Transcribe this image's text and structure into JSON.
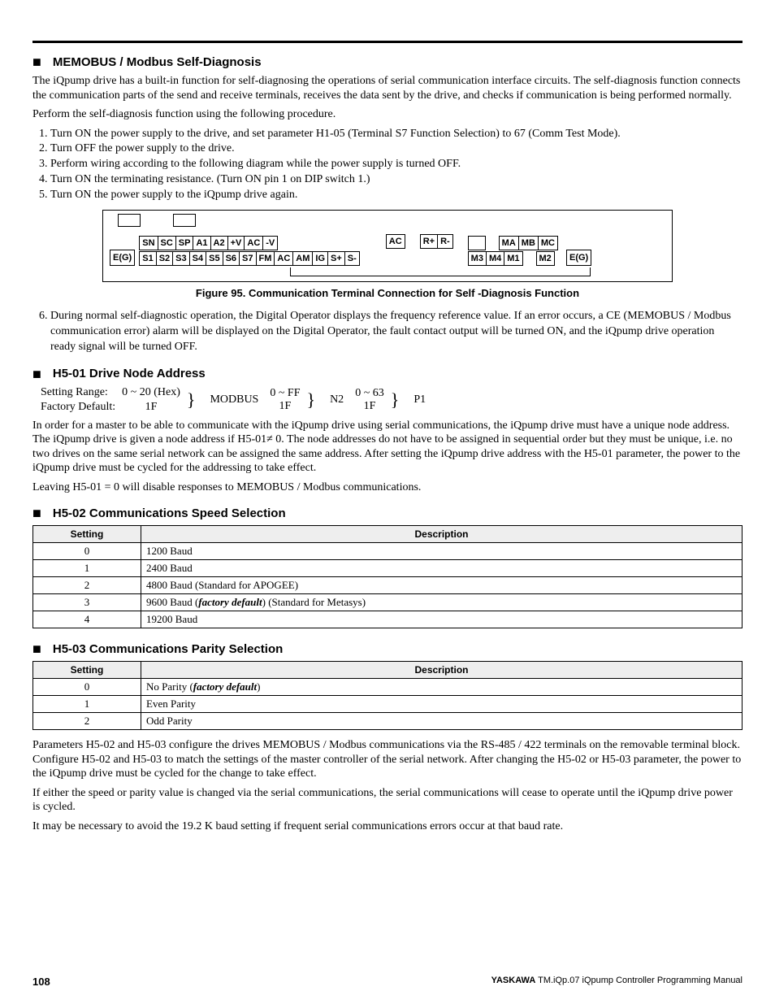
{
  "headings": {
    "selfdiag": "MEMOBUS / Modbus Self-Diagnosis",
    "h501": "H5-01 Drive Node Address",
    "h502": "H5-02 Communications Speed Selection",
    "h503": "H5-03 Communications Parity Selection"
  },
  "paragraphs": {
    "intro1": "The iQpump drive has a built-in function for self-diagnosing the operations of serial communication interface circuits. The self-diagnosis function connects the communication parts of the send and receive terminals, receives the data sent by the drive, and checks if communication is being performed normally.",
    "intro2": "Perform the self-diagnosis function using the following procedure.",
    "h501_a": "In order for a master to be able to communicate with the iQpump drive using serial communications, the iQpump drive must have a unique node address. The iQpump drive is given a node address if H5-01≠ 0. The node addresses do not have to be assigned in sequential order but they must be unique, i.e. no two drives on the same serial network can be assigned the same address. After setting the iQpump drive address with the H5-01 parameter, the power to the iQpump drive must be cycled for the addressing to take effect.",
    "h501_b": "Leaving H5-01 = 0 will disable responses to MEMOBUS / Modbus communications.",
    "h5023_a": "Parameters H5-02 and H5-03 configure the drives MEMOBUS / Modbus communications via the RS-485 / 422 terminals on the removable terminal block. Configure H5-02 and H5-03 to match the settings of the master controller of the serial network. After changing the H5-02 or H5-03 parameter, the power to the iQpump drive must be cycled for the change to take effect.",
    "h5023_b": "If either the speed or parity value is changed via the serial communications, the serial communications will cease to operate until the iQpump drive power is cycled.",
    "h5023_c": "It may be necessary to avoid the 19.2 K baud setting if frequent serial communications errors occur at that baud rate."
  },
  "steps": {
    "s1": "Turn ON the power supply to the drive, and set parameter H1-05 (Terminal S7 Function Selection) to 67 (Comm Test Mode).",
    "s2": "Turn OFF the power supply to the drive.",
    "s3": "Perform wiring according to the following diagram while the power supply is turned OFF.",
    "s4": "Turn ON the terminating resistance. (Turn ON pin 1 on DIP switch 1.)",
    "s5": "Turn ON the power supply to the iQpump drive again.",
    "s6": "During normal self-diagnostic operation, the Digital Operator displays the frequency reference value. If an error occurs, a CE (MEMOBUS / Modbus communication error) alarm will be displayed on the Digital Operator, the fault contact output will be turned ON, and the iQpump drive operation ready signal will be turned OFF."
  },
  "figure_caption": "Figure 95.  Communication Terminal Connection for Self -Diagnosis Function",
  "terminals": {
    "eg": "E(G)",
    "row1": [
      "SN",
      "SC",
      "SP",
      "A1",
      "A2",
      "+V",
      "AC",
      "-V"
    ],
    "ac_mid": "AC",
    "r_plus": "R+",
    "r_minus": "R-",
    "mabc": [
      "MA",
      "MB",
      "MC"
    ],
    "row2": [
      "S1",
      "S2",
      "S3",
      "S4",
      "S5",
      "S6",
      "S7",
      "FM",
      "AC",
      "AM",
      "IG",
      "S+",
      "S-"
    ],
    "mrow": [
      "M3",
      "M4",
      "M1"
    ],
    "m2": "M2"
  },
  "h501_spec": {
    "label_range": "Setting Range:",
    "range_val": "0 ~ 20 (Hex)",
    "label_default": "Factory Default:",
    "default_val": "1F",
    "modbus": "MODBUS",
    "col2_top": "0 ~ FF",
    "col2_bot": "1F",
    "n2": "N2",
    "col3_top": "0 ~ 63",
    "col3_bot": "1F",
    "p1": "P1"
  },
  "table_headers": {
    "setting": "Setting",
    "description": "Description"
  },
  "h502_rows": [
    {
      "setting": "0",
      "desc_pre": "1200 Baud",
      "fdef": "",
      "desc_post": ""
    },
    {
      "setting": "1",
      "desc_pre": "2400 Baud",
      "fdef": "",
      "desc_post": ""
    },
    {
      "setting": "2",
      "desc_pre": "4800 Baud (Standard for APOGEE)",
      "fdef": "",
      "desc_post": ""
    },
    {
      "setting": "3",
      "desc_pre": "9600 Baud (",
      "fdef": "factory default",
      "desc_post": ") (Standard for Metasys)"
    },
    {
      "setting": "4",
      "desc_pre": "19200 Baud",
      "fdef": "",
      "desc_post": ""
    }
  ],
  "h503_rows": [
    {
      "setting": "0",
      "desc_pre": "No Parity (",
      "fdef": "factory default",
      "desc_post": ")"
    },
    {
      "setting": "1",
      "desc_pre": "Even Parity",
      "fdef": "",
      "desc_post": ""
    },
    {
      "setting": "2",
      "desc_pre": "Odd Parity",
      "fdef": "",
      "desc_post": ""
    }
  ],
  "footer": {
    "page": "108",
    "brand": "YASKAWA",
    "doc": " TM.iQp.07 iQpump Controller Programming Manual"
  }
}
